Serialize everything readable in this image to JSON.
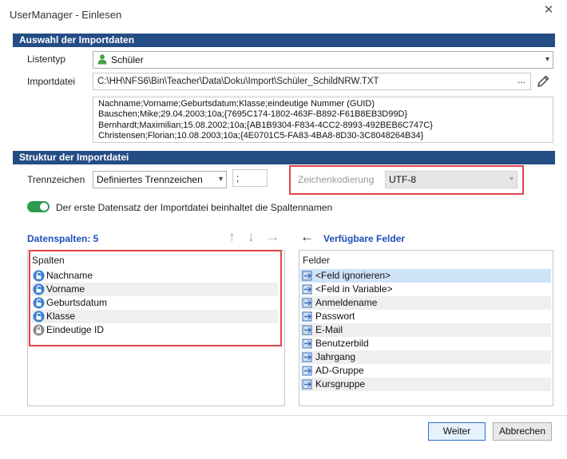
{
  "window": {
    "title": "UserManager - Einlesen",
    "close": "✕"
  },
  "import_section": {
    "header": "Auswahl der Importdaten",
    "listentyp_label": "Listentyp",
    "listentyp_value": "Schüler",
    "importdatei_label": "Importdatei",
    "importdatei_path": "C:\\HH\\NFS6\\Bin\\Teacher\\Data\\Doku\\Import\\Schüler_SchildNRW.TXT",
    "browse_label": "...",
    "preview_lines": [
      "Nachname;Vorname;Geburtsdatum;Klasse;eindeutige Nummer (GUID)",
      "Bauschen;Mike;29.04.2003;10a;{7695C174-1802-463F-B892-F61B8EB3D99D}",
      "Bernhardt;Maximilian;15.08.2002;10a;{AB1B9304-F834-4CC2-8993-492BEB6C747C}",
      "Christensen;Florian;10.08.2003;10a;{4E0701C5-FA83-4BA8-8D30-3C8048264B34}"
    ]
  },
  "structure_section": {
    "header": "Struktur der Importdatei",
    "trennzeichen_label": "Trennzeichen",
    "trennzeichen_value": "Definiertes Trennzeichen",
    "separator_value": ";",
    "zeichenkodierung_label": "Zeichenkodierung",
    "zeichenkodierung_value": "UTF-8",
    "toggle_label": "Der erste Datensatz der Importdatei beinhaltet die Spaltennamen",
    "toggle_on": true
  },
  "datenspalten": {
    "title": "Datenspalten: 5",
    "column_header": "Spalten",
    "items": [
      "Nachname",
      "Vorname",
      "Geburtsdatum",
      "Klasse",
      "Eindeutige ID"
    ],
    "move_up": "↑",
    "move_down": "↓",
    "move_right": "→"
  },
  "verfuegbare_felder": {
    "title": "Verfügbare Felder",
    "back_arrow": "←",
    "column_header": "Felder",
    "items": [
      "<Feld ignorieren>",
      "<Feld in Variable>",
      "Anmeldename",
      "Passwort",
      "E-Mail",
      "Benutzerbild",
      "Jahrgang",
      "AD-Gruppe",
      "Kursgruppe"
    ]
  },
  "buttons": {
    "weiter": "Weiter",
    "abbrechen": "Abbrechen"
  },
  "colors": {
    "header_bg": "#244d84",
    "accent_blue": "#1f4fb5",
    "toggle_green": "#2e9a4d",
    "highlight_red": "#e0444b"
  }
}
